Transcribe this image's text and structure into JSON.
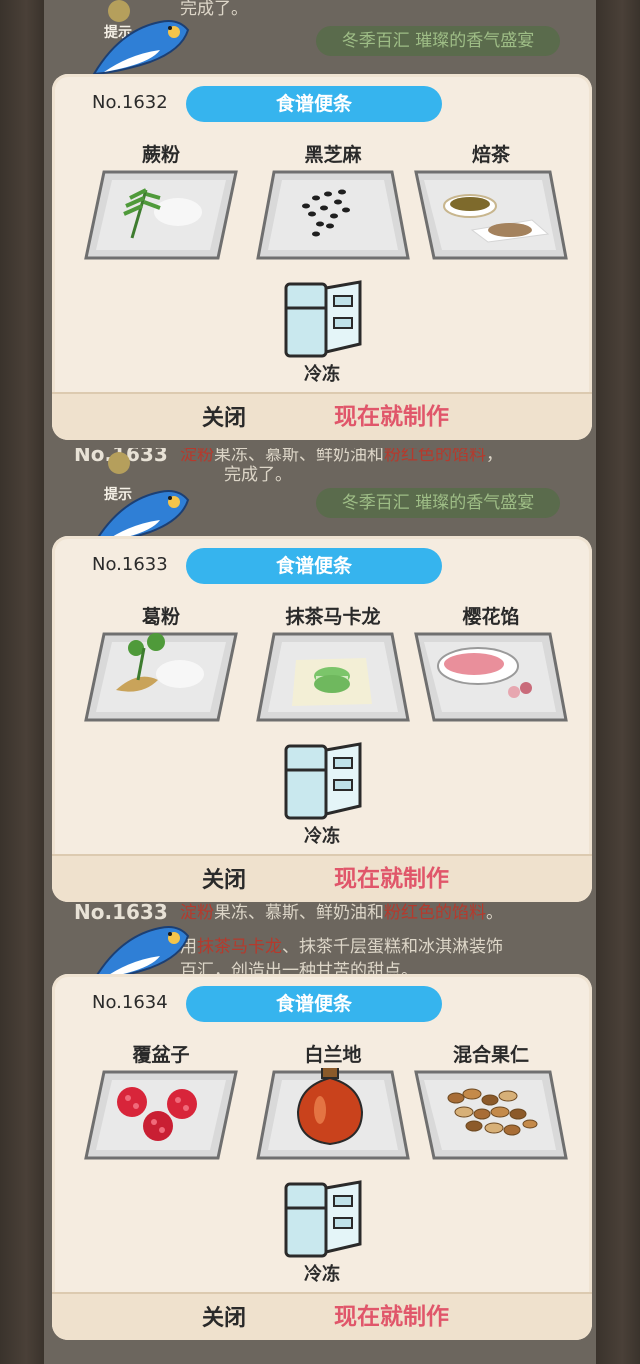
{
  "cards": [
    {
      "background": {
        "number": "",
        "lines": [
          {
            "parts": [
              {
                "text": "完成了。",
                "red": false
              }
            ]
          }
        ],
        "hint_label": "提示",
        "event": "冬季百汇 璀璨的香气盛宴"
      },
      "number": "No.1632",
      "title": "食谱便条",
      "ingredients": [
        {
          "name": "蕨粉",
          "icon": "fern-powder-icon"
        },
        {
          "name": "黑芝麻",
          "icon": "black-sesame-icon"
        },
        {
          "name": "焙茶",
          "icon": "roasted-tea-icon"
        }
      ],
      "method": "冷冻",
      "close_label": "关闭",
      "make_label": "现在就制作"
    },
    {
      "background": {
        "number": "No.1633",
        "lines": [
          {
            "parts": [
              {
                "text": "淀粉",
                "red": true
              },
              {
                "text": "果冻、慕斯、鲜奶油和",
                "red": false
              },
              {
                "text": "粉红色的馅料",
                "red": true
              },
              {
                "text": "，",
                "red": false
              }
            ]
          },
          {
            "parts": [
              {
                "text": "完成了。",
                "red": false
              }
            ]
          }
        ],
        "hint_label": "提示",
        "event": "冬季百汇 璀璨的香气盛宴"
      },
      "number": "No.1633",
      "title": "食谱便条",
      "ingredients": [
        {
          "name": "葛粉",
          "icon": "kudzu-powder-icon"
        },
        {
          "name": "抹茶马卡龙",
          "icon": "matcha-macaron-icon"
        },
        {
          "name": "樱花馅",
          "icon": "sakura-paste-icon"
        }
      ],
      "method": "冷冻",
      "close_label": "关闭",
      "make_label": "现在就制作"
    },
    {
      "background": {
        "number": "No.1633",
        "lines": [
          {
            "parts": [
              {
                "text": "淀粉",
                "red": true
              },
              {
                "text": "果冻、慕斯、鲜奶油和",
                "red": false
              },
              {
                "text": "粉红色的馅料",
                "red": true
              },
              {
                "text": "。",
                "red": false
              }
            ]
          },
          {
            "parts": [
              {
                "text": "用",
                "red": false
              },
              {
                "text": "抹茶马卡龙",
                "red": true
              },
              {
                "text": "、抹茶千层蛋糕和冰淇淋装饰",
                "red": false
              }
            ]
          },
          {
            "parts": [
              {
                "text": "百汇，创造出一种甘苦的甜点。",
                "red": false
              }
            ]
          }
        ],
        "hint_label": "",
        "event": ""
      },
      "number": "No.1634",
      "title": "食谱便条",
      "ingredients": [
        {
          "name": "覆盆子",
          "icon": "raspberry-icon"
        },
        {
          "name": "白兰地",
          "icon": "brandy-bottle-icon"
        },
        {
          "name": "混合果仁",
          "icon": "mixed-nuts-icon"
        }
      ],
      "method": "冷冻",
      "close_label": "关闭",
      "make_label": "现在就制作"
    }
  ]
}
